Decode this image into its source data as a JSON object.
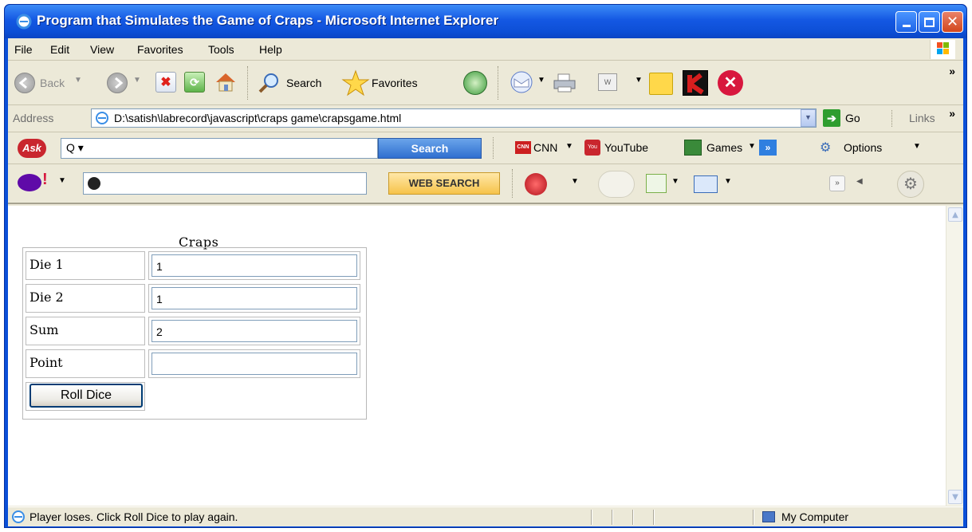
{
  "window": {
    "title": "Program that Simulates the Game of Craps - Microsoft Internet Explorer",
    "buttons": [
      "minimize",
      "maximize",
      "close"
    ]
  },
  "menu": [
    "File",
    "Edit",
    "View",
    "Favorites",
    "Tools",
    "Help"
  ],
  "toolbar": {
    "back": "Back",
    "search": "Search",
    "favorites": "Favorites"
  },
  "address": {
    "label": "Address",
    "url": "D:\\satish\\labrecord\\javascript\\craps game\\crapsgame.html",
    "go": "Go",
    "links": "Links"
  },
  "ask_toolbar": {
    "logo": "Ask",
    "search_button": "Search",
    "cnn": "CNN",
    "youtube": "YouTube",
    "games": "Games",
    "options": "Options"
  },
  "yahoo_toolbar": {
    "web_search": "WEB SEARCH"
  },
  "page": {
    "caption": "Craps",
    "rows": [
      {
        "label": "Die 1",
        "value": "1"
      },
      {
        "label": "Die 2",
        "value": "1"
      },
      {
        "label": "Sum",
        "value": "2"
      },
      {
        "label": "Point",
        "value": ""
      }
    ],
    "roll_button": "Roll Dice"
  },
  "status": {
    "message": "Player loses. Click Roll Dice to play again.",
    "zone": "My Computer"
  },
  "colors": {
    "titlebar": "#0d4fd6",
    "chrome": "#ece9d8",
    "ask_search": "#3b82d6",
    "yahoo_purple": "#5f0aa8"
  }
}
